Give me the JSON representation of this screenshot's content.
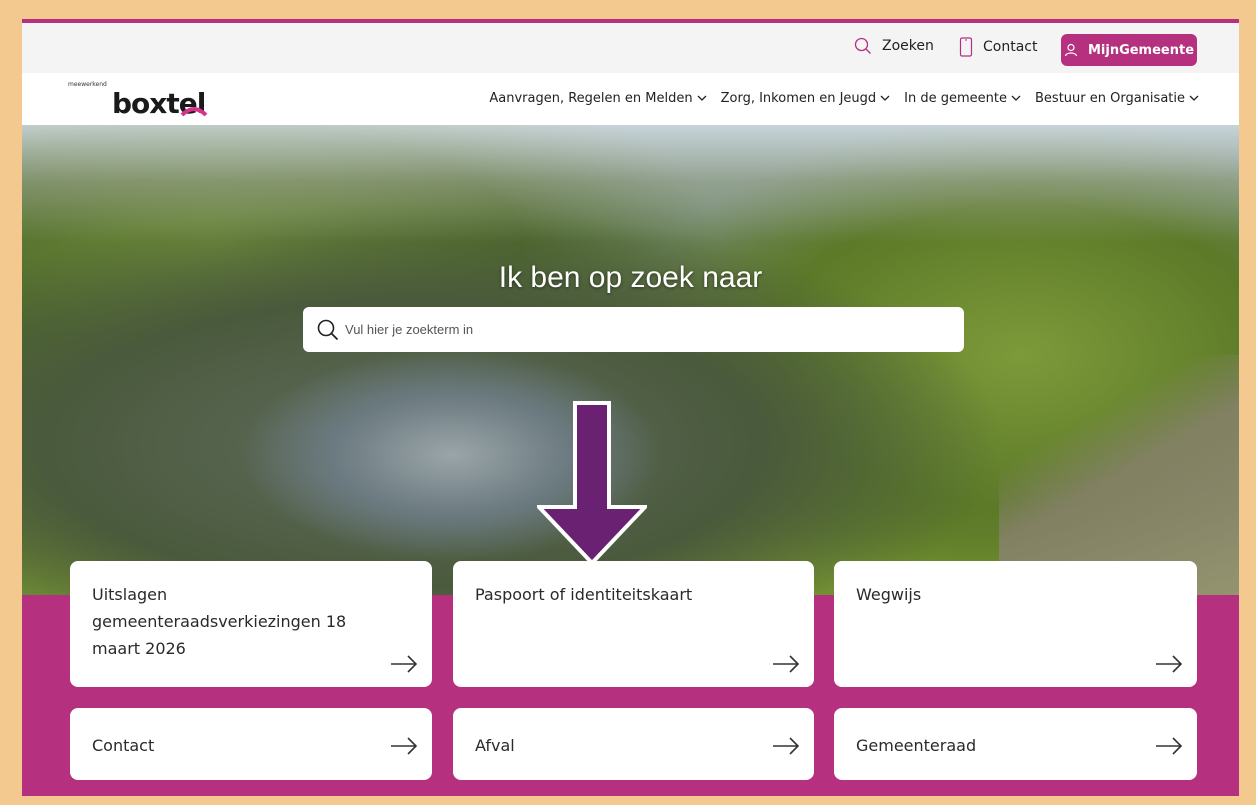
{
  "utility": {
    "search_label": "Zoeken",
    "contact_label": "Contact",
    "mijn_label": "MijnGemeente"
  },
  "logo": {
    "tagline": "meewerkend",
    "name": "boxtel"
  },
  "nav": {
    "items": [
      {
        "label": "Aanvragen, Regelen en Melden"
      },
      {
        "label": "Zorg, Inkomen en Jeugd"
      },
      {
        "label": "In de gemeente"
      },
      {
        "label": "Bestuur en Organisatie"
      }
    ]
  },
  "hero": {
    "title": "Ik ben op zoek naar",
    "search_placeholder": "Vul hier je zoekterm in"
  },
  "tiles": [
    {
      "label": "Uitslagen gemeenteraadsverkiezingen 18 maart 2026"
    },
    {
      "label": "Paspoort of identiteitskaart"
    },
    {
      "label": "Wegwijs"
    },
    {
      "label": "Contact"
    },
    {
      "label": "Afval"
    },
    {
      "label": "Gemeenteraad"
    }
  ],
  "colors": {
    "brand": "#b5317f",
    "annotation_arrow": "#6b2172",
    "page_border": "#f4c990"
  },
  "icons": {
    "search": "search-icon",
    "phone": "phone-icon",
    "user": "user-icon",
    "chevron": "chevron-down-icon",
    "arrow": "arrow-right-icon"
  }
}
